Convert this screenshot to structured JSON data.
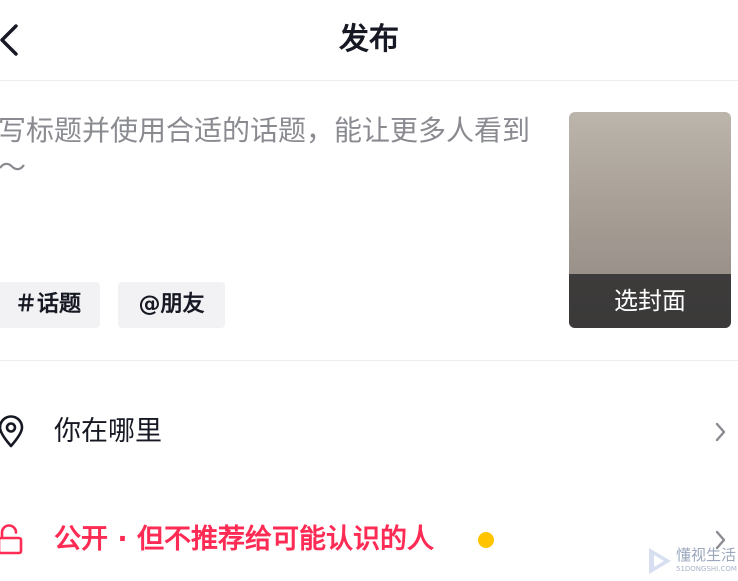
{
  "header": {
    "title": "发布"
  },
  "caption": {
    "placeholder": "写标题并使用合适的话题，能让更多人看到～",
    "value": ""
  },
  "chips": {
    "topic": "＃话题",
    "friend": "@朋友"
  },
  "cover": {
    "label": "选封面"
  },
  "location": {
    "label": "你在哪里"
  },
  "privacy": {
    "label": "公开 · 但不推荐给可能认识的人",
    "dot_color": "#ffc300"
  },
  "watermark": {
    "text": "懂视生活",
    "sub": "51DONGSHI.COM"
  },
  "colors": {
    "accent": "#fe2c55",
    "text": "#161823",
    "placeholder": "#8a8b91"
  }
}
